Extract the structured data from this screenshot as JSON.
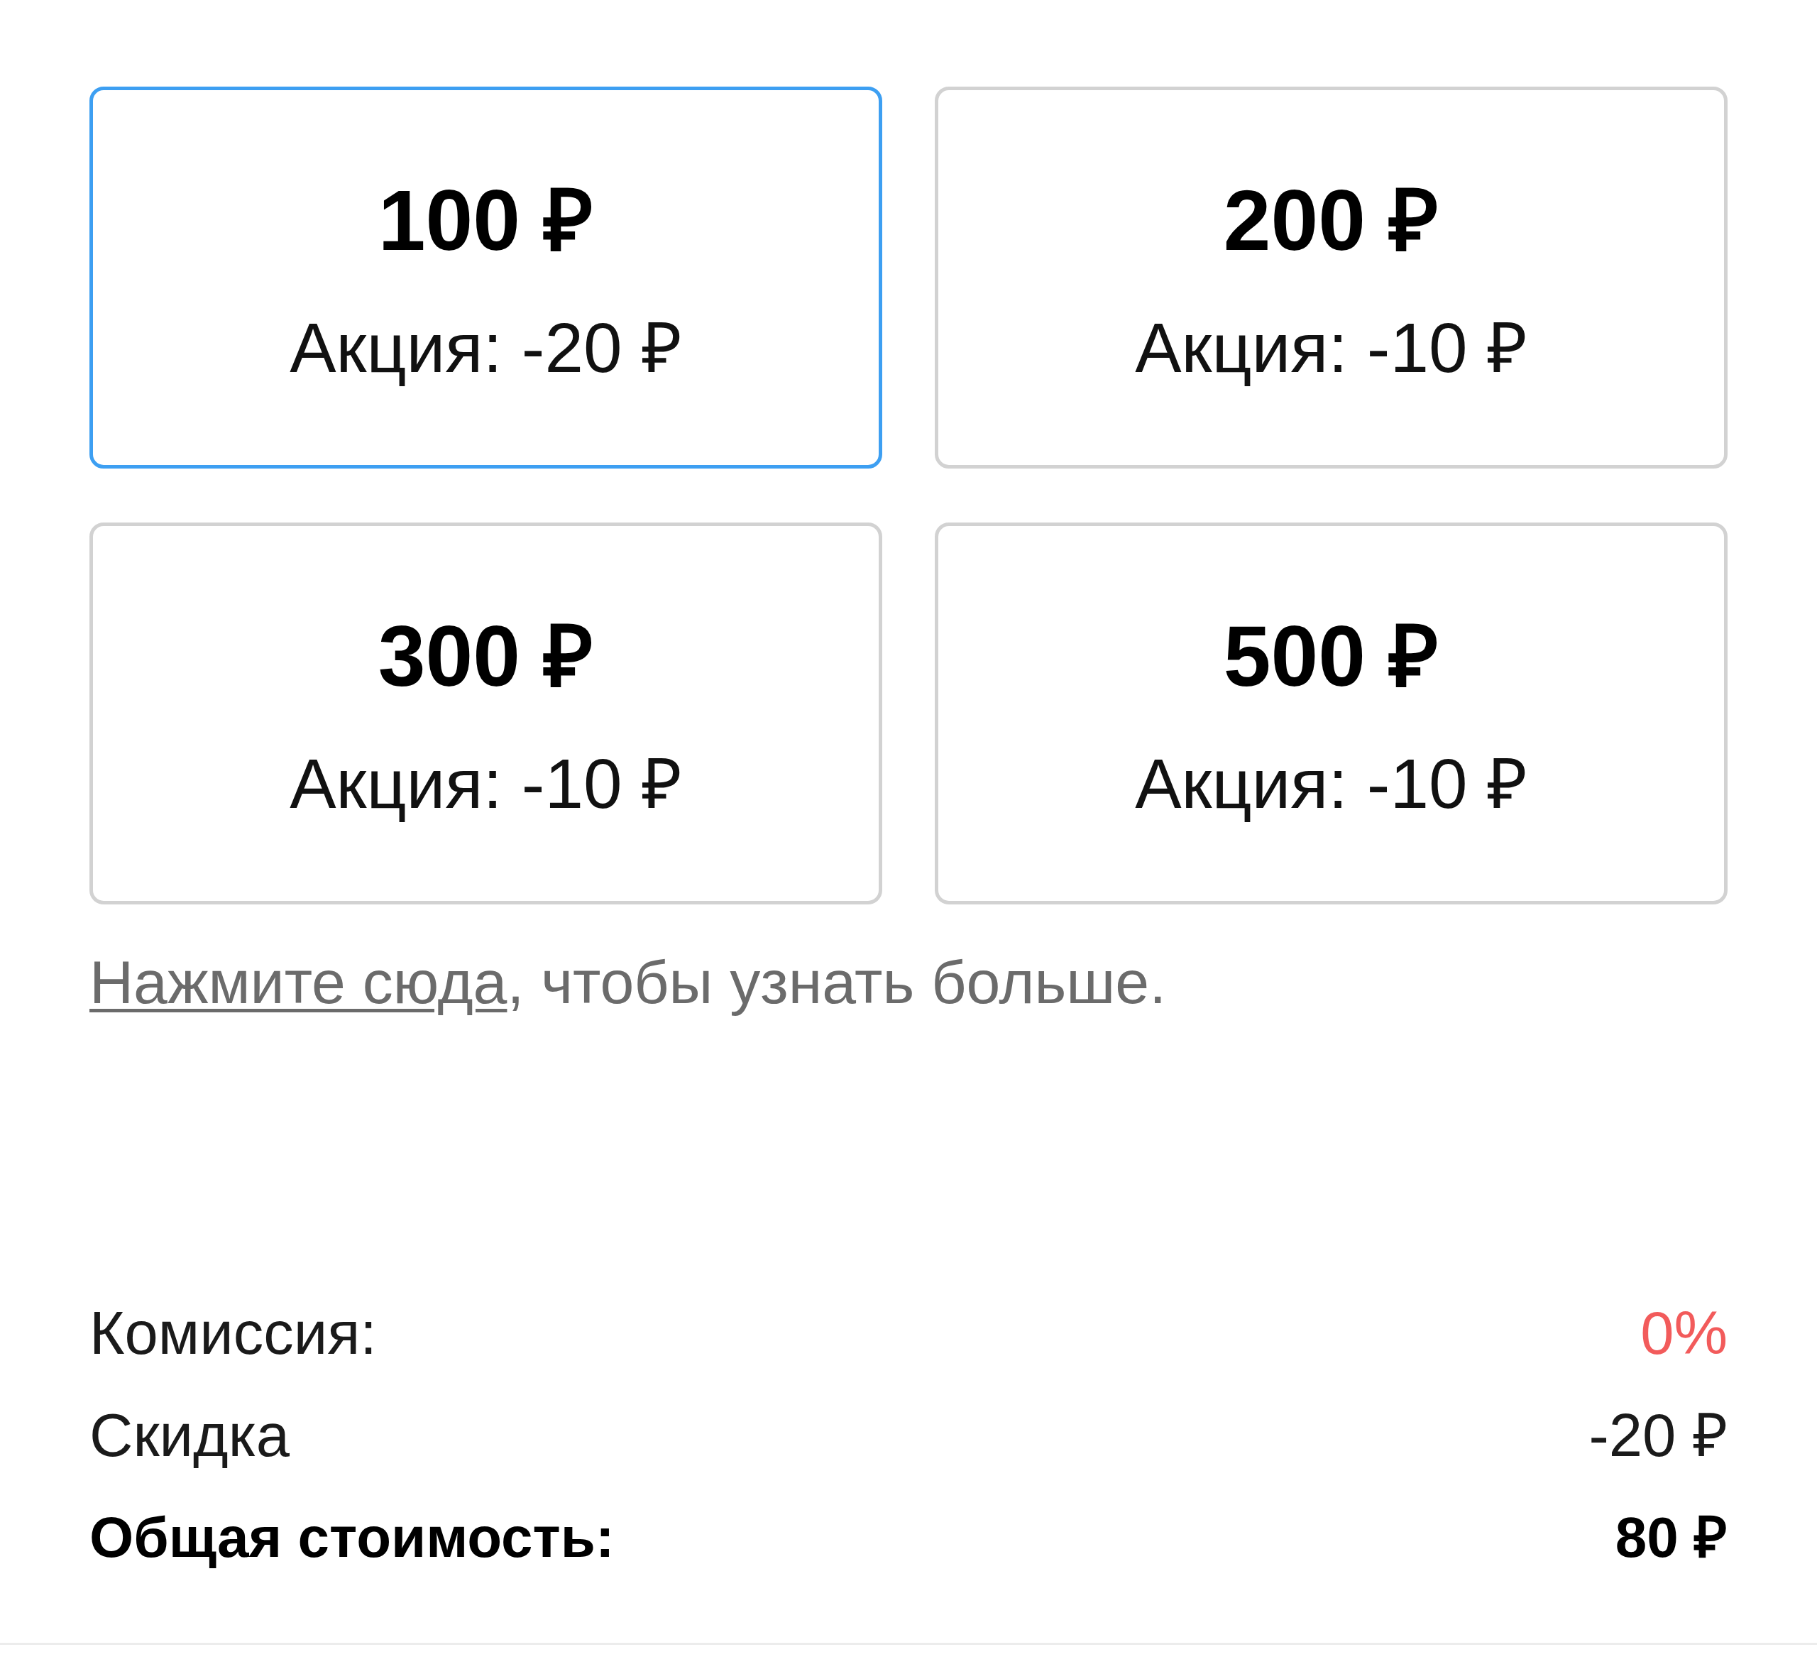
{
  "options": [
    {
      "price": "100 ₽",
      "promo": "Акция: -20 ₽",
      "selected": true
    },
    {
      "price": "200 ₽",
      "promo": "Акция: -10 ₽",
      "selected": false
    },
    {
      "price": "300 ₽",
      "promo": "Акция: -10 ₽",
      "selected": false
    },
    {
      "price": "500 ₽",
      "promo": "Акция: -10 ₽",
      "selected": false
    }
  ],
  "info": {
    "link": "Нажмите сюда",
    "text": ", чтобы узнать больше."
  },
  "summary": [
    {
      "kind": "commission",
      "label": "Комиссия:",
      "value": "0%"
    },
    {
      "kind": "discount",
      "label": "Скидка",
      "value": "-20 ₽"
    },
    {
      "kind": "total",
      "label": "Общая стоимость:",
      "value": "80 ₽"
    }
  ]
}
